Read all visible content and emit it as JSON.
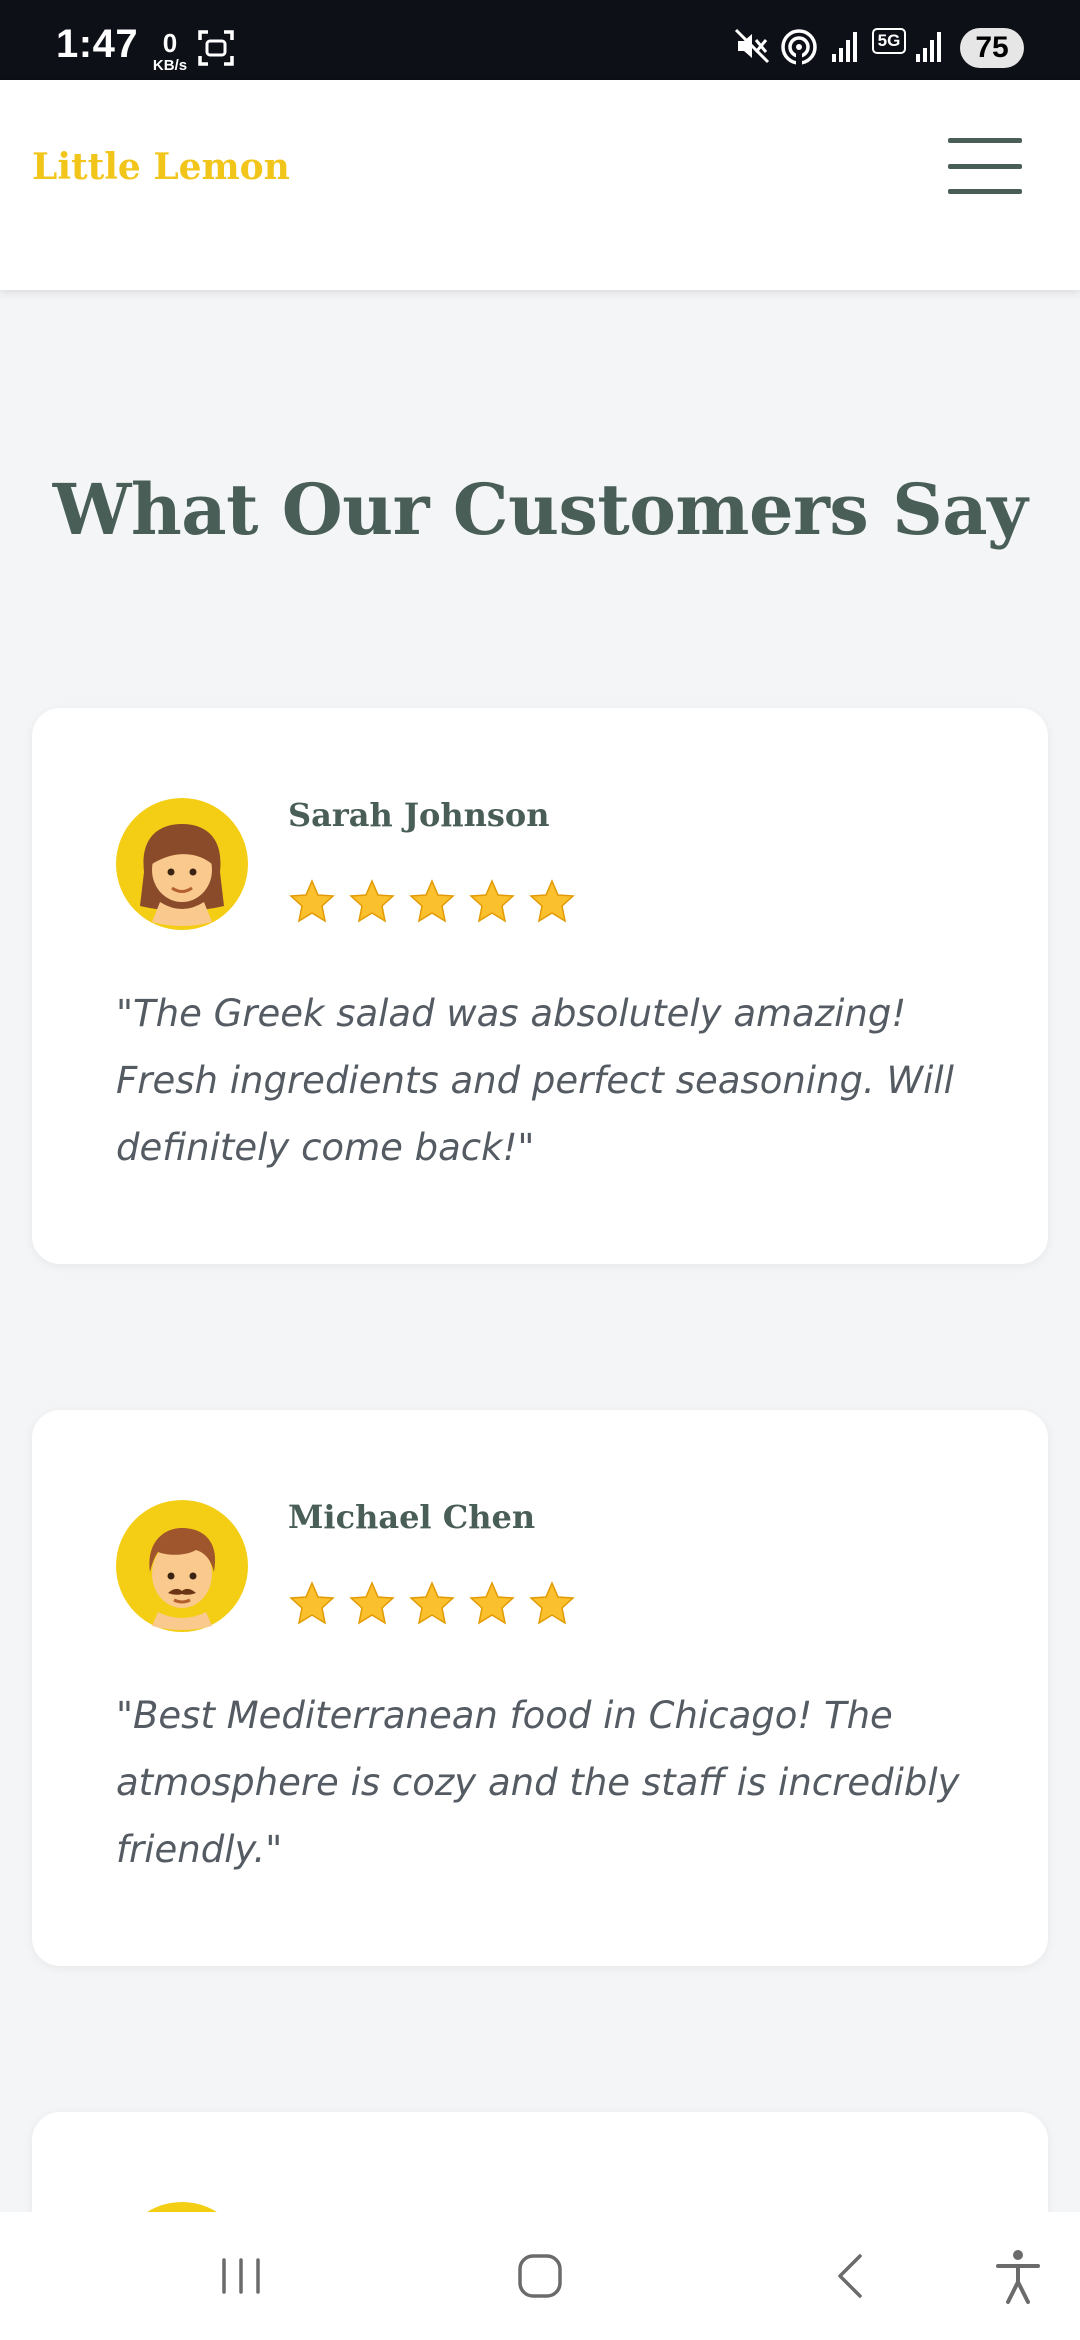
{
  "status_bar": {
    "time": "1:47",
    "net_speed_value": "0",
    "net_speed_unit": "KB/s",
    "network_label": "5G",
    "battery": "75"
  },
  "header": {
    "brand": "Little Lemon",
    "menu_icon": "hamburger-menu-icon"
  },
  "testimonials": {
    "title": "What Our Customers Say",
    "reviews": [
      {
        "name": "Sarah Johnson",
        "avatar": "woman-emoji",
        "rating": 5,
        "text": "\"The Greek salad was absolutely amazing! Fresh ingredients and perfect seasoning. Will definitely come back!\""
      },
      {
        "name": "Michael Chen",
        "avatar": "man-with-mustache-emoji",
        "rating": 5,
        "text": "\"Best Mediterranean food in Chicago! The atmosphere is cozy and the staff is incredibly friendly.\""
      }
    ]
  },
  "colors": {
    "brand_yellow": "#f4ce14",
    "brand_green": "#495e57",
    "page_background": "#f4f5f7",
    "star": "#f7b500"
  },
  "nav_bar": {
    "icons": [
      "recent-apps-icon",
      "home-icon",
      "back-icon",
      "accessibility-icon"
    ]
  }
}
